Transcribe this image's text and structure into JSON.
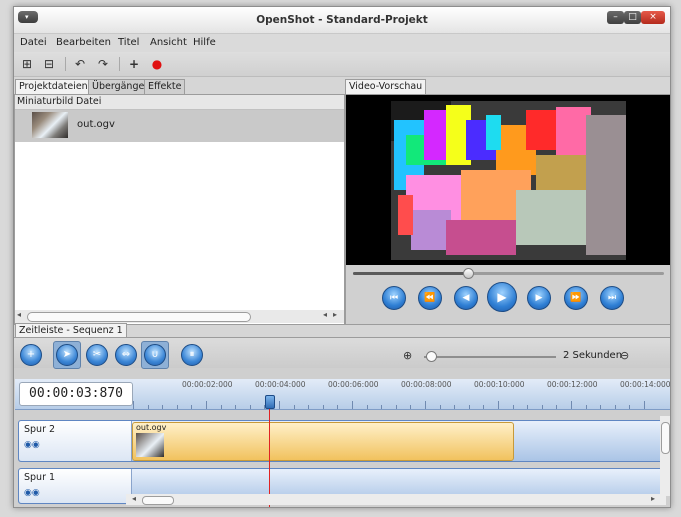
{
  "window": {
    "title": "OpenShot - Standard-Projekt",
    "menu_glyph": "▾",
    "buttons": {
      "minimize": "–",
      "maximize": "□",
      "close": "×"
    }
  },
  "menu": [
    "Datei",
    "Bearbeiten",
    "Titel",
    "Ansicht",
    "Hilfe"
  ],
  "toolbar": {
    "icons": [
      "import-files-icon",
      "import-image-sequence-icon",
      "undo-icon",
      "redo-icon",
      "add-track-icon",
      "record-icon"
    ],
    "glyphs": {
      "import": "⊞",
      "import_seq": "⊟",
      "undo": "↶",
      "redo": "↷",
      "add": "+",
      "record": "●"
    }
  },
  "left_panel": {
    "tabs": [
      "Projektdateien",
      "Übergänge",
      "Effekte"
    ],
    "columns": [
      "Miniaturbild",
      "Datei"
    ],
    "files": [
      {
        "name": "out.ogv"
      }
    ],
    "scroll_arrows": {
      "left": "◂",
      "right": "▸"
    }
  },
  "preview": {
    "tab": "Video-Vorschau",
    "progress": 0.37,
    "controls": {
      "labels": [
        "jump-start",
        "rewind-fast",
        "rewind",
        "play",
        "forward",
        "forward-fast",
        "jump-end"
      ],
      "glyphs": [
        "⏮",
        "⏪",
        "◀",
        "▶",
        "▶",
        "⏩",
        "⏭"
      ]
    }
  },
  "timeline": {
    "tab": "Zeitleiste - Sequenz 1",
    "tool_glyphs": {
      "add": "+",
      "select": "➤",
      "razor": "✂",
      "resize": "⇔",
      "snap": "∪",
      "marker": "⏸"
    },
    "zoom_in_glyph": "⊕",
    "zoom_out_glyph": "⊖",
    "zoom_label": "2 Sekunden",
    "timecode": "00:00:03:870",
    "ticks": [
      "00:00:02:000",
      "00:00:04:000",
      "00:00:06:000",
      "00:00:08:000",
      "00:00:10:000",
      "00:00:12:000",
      "00:00:14:000"
    ],
    "track_icon_glyphs": "◉◉",
    "tracks": [
      {
        "name": "Spur 2",
        "clip": "out.ogv"
      },
      {
        "name": "Spur 1",
        "clip": ""
      }
    ]
  },
  "colors": {
    "accent": "#3b86d6",
    "playhead": "#e02323",
    "clip": "#f1c25e"
  }
}
